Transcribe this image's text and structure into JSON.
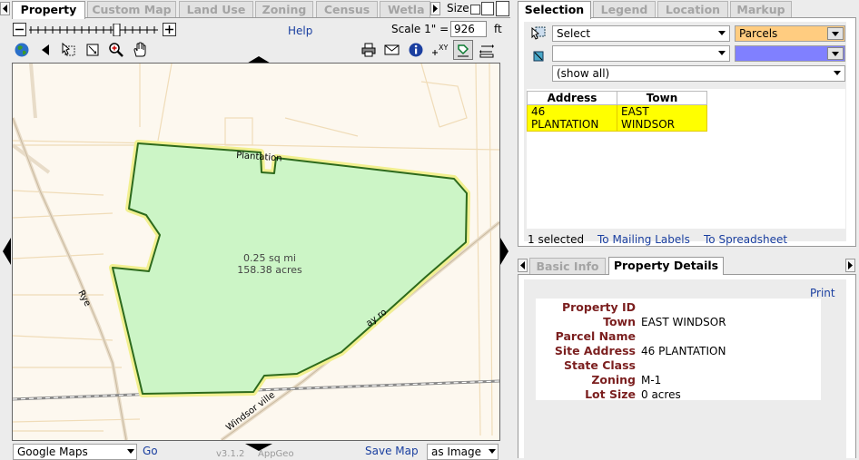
{
  "left_tabs": [
    "Property",
    "Custom Map",
    "Land Use",
    "Zoning",
    "Census",
    "Wetla"
  ],
  "size_label": "Size",
  "help_label": "Help",
  "scale": {
    "label": "Scale 1\" =",
    "value": "926",
    "unit": "ft"
  },
  "map": {
    "area_sq_mi": "0.25 sq mi",
    "area_acres": "158.38 acres",
    "street_labels": [
      "Plantation",
      "Rye",
      "Windsor ville",
      "ay ro"
    ]
  },
  "bottom_bar": {
    "basemap": "Google Maps",
    "go_label": "Go",
    "version": "v3.1.2",
    "credit": "AppGeo",
    "save_map": "Save Map",
    "format": "as Image"
  },
  "right_tabs": [
    "Selection",
    "Legend",
    "Location",
    "Markup"
  ],
  "selection": {
    "action": "Select",
    "layer": "Parcels",
    "target_layer": "",
    "filter": "(show all)",
    "columns": [
      "Address",
      "Town"
    ],
    "rows": [
      [
        "46 PLANTATION",
        "EAST WINDSOR"
      ]
    ],
    "count_text": "1 selected",
    "mailing_labels": "To Mailing Labels",
    "spreadsheet": "To Spreadsheet"
  },
  "info_tabs": [
    "Basic Info",
    "Property Details"
  ],
  "print_label": "Print",
  "details": [
    {
      "label": "Property ID",
      "value": ""
    },
    {
      "label": "Town",
      "value": "EAST WINDSOR"
    },
    {
      "label": "Parcel Name",
      "value": ""
    },
    {
      "label": "Site Address",
      "value": "46 PLANTATION"
    },
    {
      "label": "State Class",
      "value": ""
    },
    {
      "label": "Zoning",
      "value": "M-1"
    },
    {
      "label": "Lot Size",
      "value": "0 acres"
    }
  ],
  "colors": {
    "parcel_fill": "#ccf5c6",
    "parcel_stroke": "#2d6a1d",
    "highlight": "#ffff00",
    "layer_orange": "#ffcc80",
    "layer_blue": "#8080ff"
  }
}
